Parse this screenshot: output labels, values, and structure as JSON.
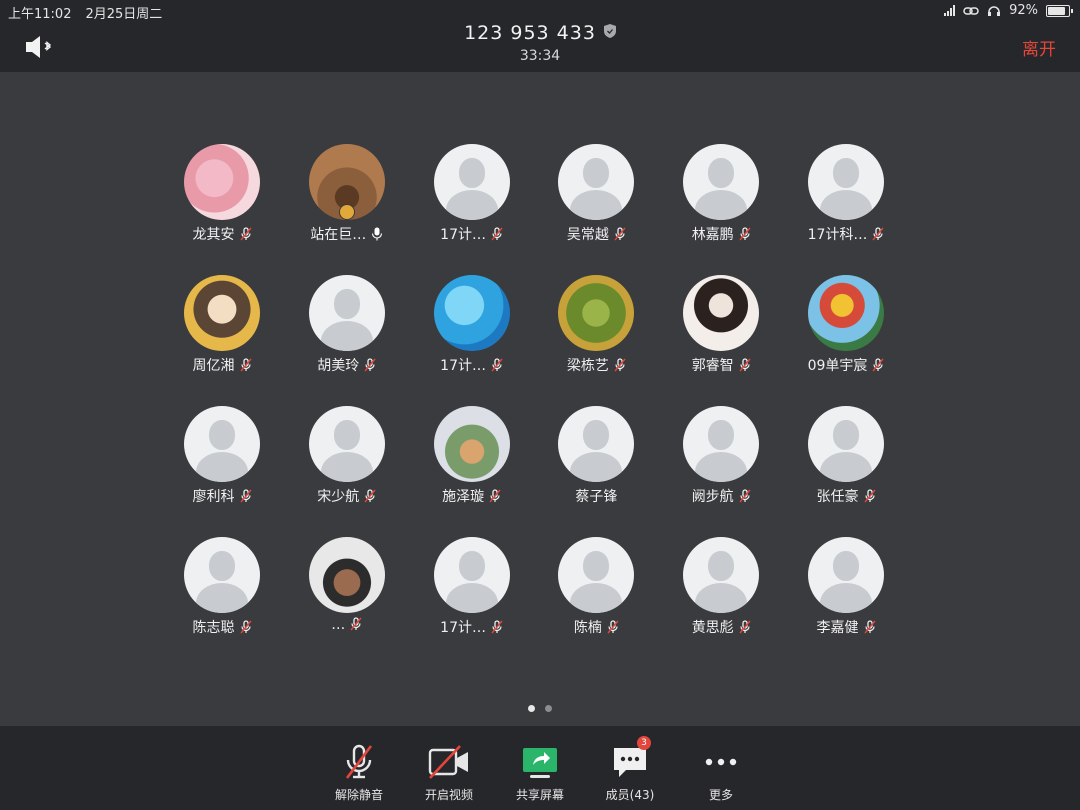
{
  "status_bar": {
    "time": "上午11:02",
    "date": "2月25日周二",
    "battery": "92%",
    "battery_level": 0.92
  },
  "meeting": {
    "id": "123 953 433",
    "duration": "33:34",
    "leave_label": "离开"
  },
  "colors": {
    "leave": "#e2463c",
    "share_screen": "#2ab56a",
    "muted_icon": "#e2463c",
    "speaking_icon": "#ffffff"
  },
  "participants": [
    {
      "name": "龙其安",
      "mic": "muted",
      "avatar": "photo"
    },
    {
      "name": "站在巨…",
      "mic": "speaking",
      "avatar": "photo",
      "host": true
    },
    {
      "name": "17计…",
      "mic": "muted",
      "avatar": "default"
    },
    {
      "name": "吴常越",
      "mic": "muted",
      "avatar": "default"
    },
    {
      "name": "林嘉鹏",
      "mic": "muted",
      "avatar": "default"
    },
    {
      "name": "17计科…",
      "mic": "muted",
      "avatar": "default"
    },
    {
      "name": "周亿湘",
      "mic": "muted",
      "avatar": "photo"
    },
    {
      "name": "胡美玲",
      "mic": "muted",
      "avatar": "default"
    },
    {
      "name": "17计…",
      "mic": "muted",
      "avatar": "photo"
    },
    {
      "name": "梁栋艺",
      "mic": "muted",
      "avatar": "photo"
    },
    {
      "name": "郭睿智",
      "mic": "muted",
      "avatar": "photo"
    },
    {
      "name": "09单宇宸",
      "mic": "muted",
      "avatar": "photo"
    },
    {
      "name": "廖利科",
      "mic": "muted",
      "avatar": "default"
    },
    {
      "name": "宋少航",
      "mic": "muted",
      "avatar": "default"
    },
    {
      "name": "施泽璇",
      "mic": "muted",
      "avatar": "photo"
    },
    {
      "name": "蔡子锋",
      "mic": "none",
      "avatar": "default"
    },
    {
      "name": "阙步航",
      "mic": "muted",
      "avatar": "default"
    },
    {
      "name": "张任豪",
      "mic": "muted",
      "avatar": "default"
    },
    {
      "name": "陈志聪",
      "mic": "muted",
      "avatar": "default"
    },
    {
      "name": "…",
      "mic": "muted",
      "avatar": "photo"
    },
    {
      "name": "17计…",
      "mic": "muted",
      "avatar": "default"
    },
    {
      "name": "陈楠",
      "mic": "muted",
      "avatar": "default"
    },
    {
      "name": "黄思彪",
      "mic": "muted",
      "avatar": "default"
    },
    {
      "name": "李嘉健",
      "mic": "muted",
      "avatar": "default"
    }
  ],
  "pagination": {
    "pages": 2,
    "current": 1
  },
  "toolbar": {
    "unmute_label": "解除静音",
    "video_label": "开启视频",
    "share_label": "共享屏幕",
    "members_label": "成员(43)",
    "members_badge": "3",
    "more_label": "更多"
  }
}
